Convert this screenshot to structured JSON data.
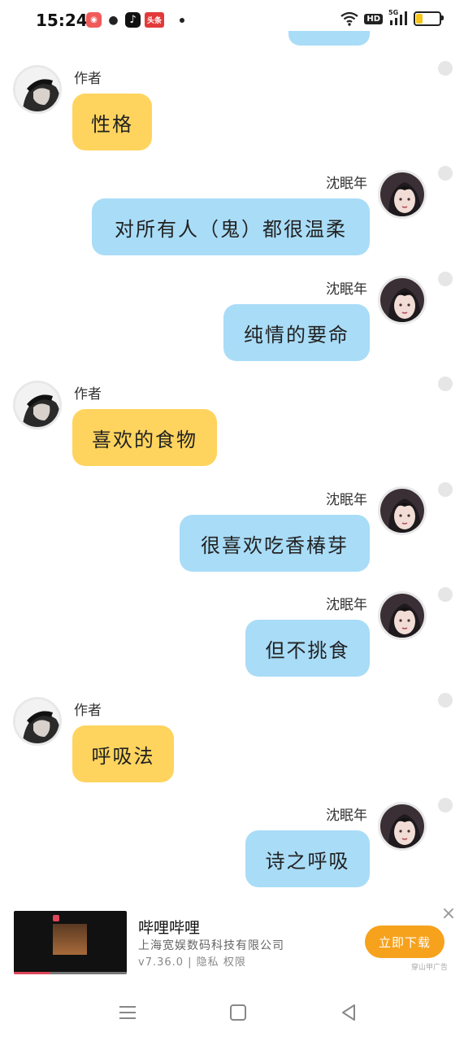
{
  "status_bar": {
    "time": "15:24",
    "app_icons": [
      {
        "name": "game-app-icon",
        "color": "#f05a5a"
      },
      {
        "name": "wechat-icon",
        "color": "#222222"
      },
      {
        "name": "douyin-icon",
        "color": "#111111"
      },
      {
        "name": "toutiao-icon",
        "color": "#e23a3a",
        "label": "头条"
      }
    ],
    "hd_label": "HD",
    "network_label": "5G",
    "battery_level_percent": 25,
    "battery_color": "#f5c518"
  },
  "colors": {
    "author_bubble": "#ffd45e",
    "user_bubble": "#a9dcf7",
    "ad_button": "#f6a21d"
  },
  "messages": [
    {
      "sender": "作者",
      "side": "left",
      "text": "性格"
    },
    {
      "sender": "沈眠年",
      "side": "right",
      "text": "对所有人（鬼）都很温柔"
    },
    {
      "sender": "沈眠年",
      "side": "right",
      "text": "纯情的要命"
    },
    {
      "sender": "作者",
      "side": "left",
      "text": "喜欢的食物"
    },
    {
      "sender": "沈眠年",
      "side": "right",
      "text": "很喜欢吃香椿芽"
    },
    {
      "sender": "沈眠年",
      "side": "right",
      "text": "但不挑食"
    },
    {
      "sender": "作者",
      "side": "left",
      "text": "呼吸法"
    },
    {
      "sender": "沈眠年",
      "side": "right",
      "text": "诗之呼吸"
    }
  ],
  "ad": {
    "title": "哔哩哔哩",
    "company": "上海宽娱数码科技有限公司",
    "meta": "v7.36.0 | 隐私 权限",
    "button": "立即下载",
    "source": "穿山甲广告",
    "close": "×"
  },
  "nav": {
    "menu_icon": "menu-icon",
    "home_icon": "home-icon",
    "back_icon": "back-icon"
  }
}
